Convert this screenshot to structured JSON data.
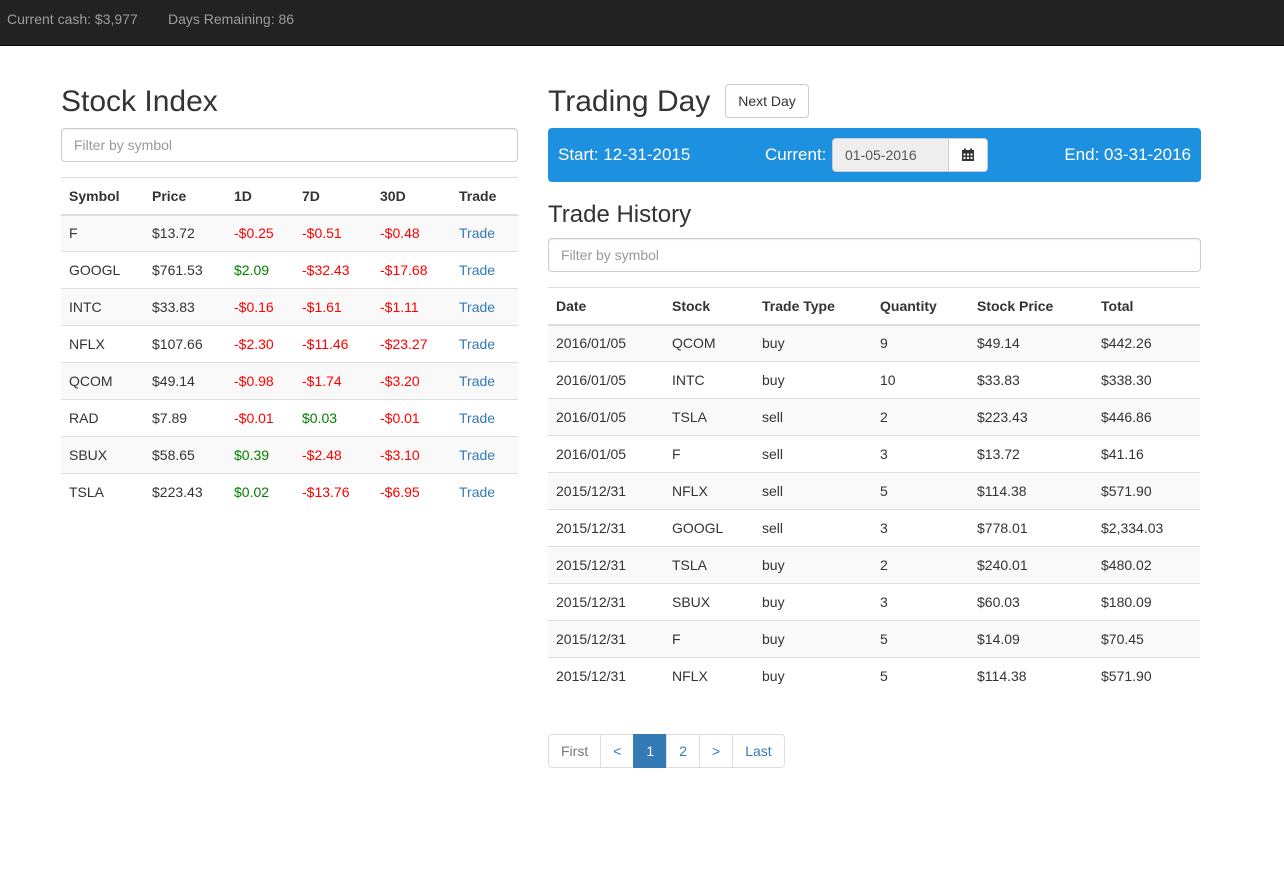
{
  "navbar": {
    "cash": "Current cash: $3,977",
    "days": "Days Remaining: 86"
  },
  "stock_index": {
    "title": "Stock Index",
    "filter_placeholder": "Filter by symbol",
    "columns": [
      "Symbol",
      "Price",
      "1D",
      "7D",
      "30D",
      "Trade"
    ],
    "rows": [
      {
        "symbol": "F",
        "price": "$13.72",
        "d1": "-$0.25",
        "d7": "-$0.51",
        "d30": "-$0.48",
        "trade": "Trade"
      },
      {
        "symbol": "GOOGL",
        "price": "$761.53",
        "d1": "$2.09",
        "d7": "-$32.43",
        "d30": "-$17.68",
        "trade": "Trade"
      },
      {
        "symbol": "INTC",
        "price": "$33.83",
        "d1": "-$0.16",
        "d7": "-$1.61",
        "d30": "-$1.11",
        "trade": "Trade"
      },
      {
        "symbol": "NFLX",
        "price": "$107.66",
        "d1": "-$2.30",
        "d7": "-$11.46",
        "d30": "-$23.27",
        "trade": "Trade"
      },
      {
        "symbol": "QCOM",
        "price": "$49.14",
        "d1": "-$0.98",
        "d7": "-$1.74",
        "d30": "-$3.20",
        "trade": "Trade"
      },
      {
        "symbol": "RAD",
        "price": "$7.89",
        "d1": "-$0.01",
        "d7": "$0.03",
        "d30": "-$0.01",
        "trade": "Trade"
      },
      {
        "symbol": "SBUX",
        "price": "$58.65",
        "d1": "$0.39",
        "d7": "-$2.48",
        "d30": "-$3.10",
        "trade": "Trade"
      },
      {
        "symbol": "TSLA",
        "price": "$223.43",
        "d1": "$0.02",
        "d7": "-$13.76",
        "d30": "-$6.95",
        "trade": "Trade"
      }
    ]
  },
  "trading_day": {
    "title": "Trading Day",
    "next_day_label": "Next Day",
    "start": "Start: 12-31-2015",
    "current_label": "Current:",
    "current_value": "01-05-2016",
    "end": "End: 03-31-2016",
    "band_color": "#1e90e0",
    "calendar_icon": "calendar-icon"
  },
  "trade_history": {
    "title": "Trade History",
    "filter_placeholder": "Filter by symbol",
    "columns": [
      "Date",
      "Stock",
      "Trade Type",
      "Quantity",
      "Stock Price",
      "Total"
    ],
    "rows": [
      {
        "date": "2016/01/05",
        "stock": "QCOM",
        "type": "buy",
        "qty": "9",
        "price": "$49.14",
        "total": "$442.26"
      },
      {
        "date": "2016/01/05",
        "stock": "INTC",
        "type": "buy",
        "qty": "10",
        "price": "$33.83",
        "total": "$338.30"
      },
      {
        "date": "2016/01/05",
        "stock": "TSLA",
        "type": "sell",
        "qty": "2",
        "price": "$223.43",
        "total": "$446.86"
      },
      {
        "date": "2016/01/05",
        "stock": "F",
        "type": "sell",
        "qty": "3",
        "price": "$13.72",
        "total": "$41.16"
      },
      {
        "date": "2015/12/31",
        "stock": "NFLX",
        "type": "sell",
        "qty": "5",
        "price": "$114.38",
        "total": "$571.90"
      },
      {
        "date": "2015/12/31",
        "stock": "GOOGL",
        "type": "sell",
        "qty": "3",
        "price": "$778.01",
        "total": "$2,334.03"
      },
      {
        "date": "2015/12/31",
        "stock": "TSLA",
        "type": "buy",
        "qty": "2",
        "price": "$240.01",
        "total": "$480.02"
      },
      {
        "date": "2015/12/31",
        "stock": "SBUX",
        "type": "buy",
        "qty": "3",
        "price": "$60.03",
        "total": "$180.09"
      },
      {
        "date": "2015/12/31",
        "stock": "F",
        "type": "buy",
        "qty": "5",
        "price": "$14.09",
        "total": "$70.45"
      },
      {
        "date": "2015/12/31",
        "stock": "NFLX",
        "type": "buy",
        "qty": "5",
        "price": "$114.38",
        "total": "$571.90"
      }
    ]
  },
  "pagination": {
    "items": [
      {
        "label": "First",
        "state": "disabled"
      },
      {
        "label": "<",
        "state": "normal"
      },
      {
        "label": "1",
        "state": "active"
      },
      {
        "label": "2",
        "state": "normal"
      },
      {
        "label": ">",
        "state": "normal"
      },
      {
        "label": "Last",
        "state": "normal"
      }
    ]
  },
  "colors": {
    "negative": "#ff0000",
    "positive": "#008000",
    "link": "#337ab7",
    "navbar": "#222222"
  }
}
